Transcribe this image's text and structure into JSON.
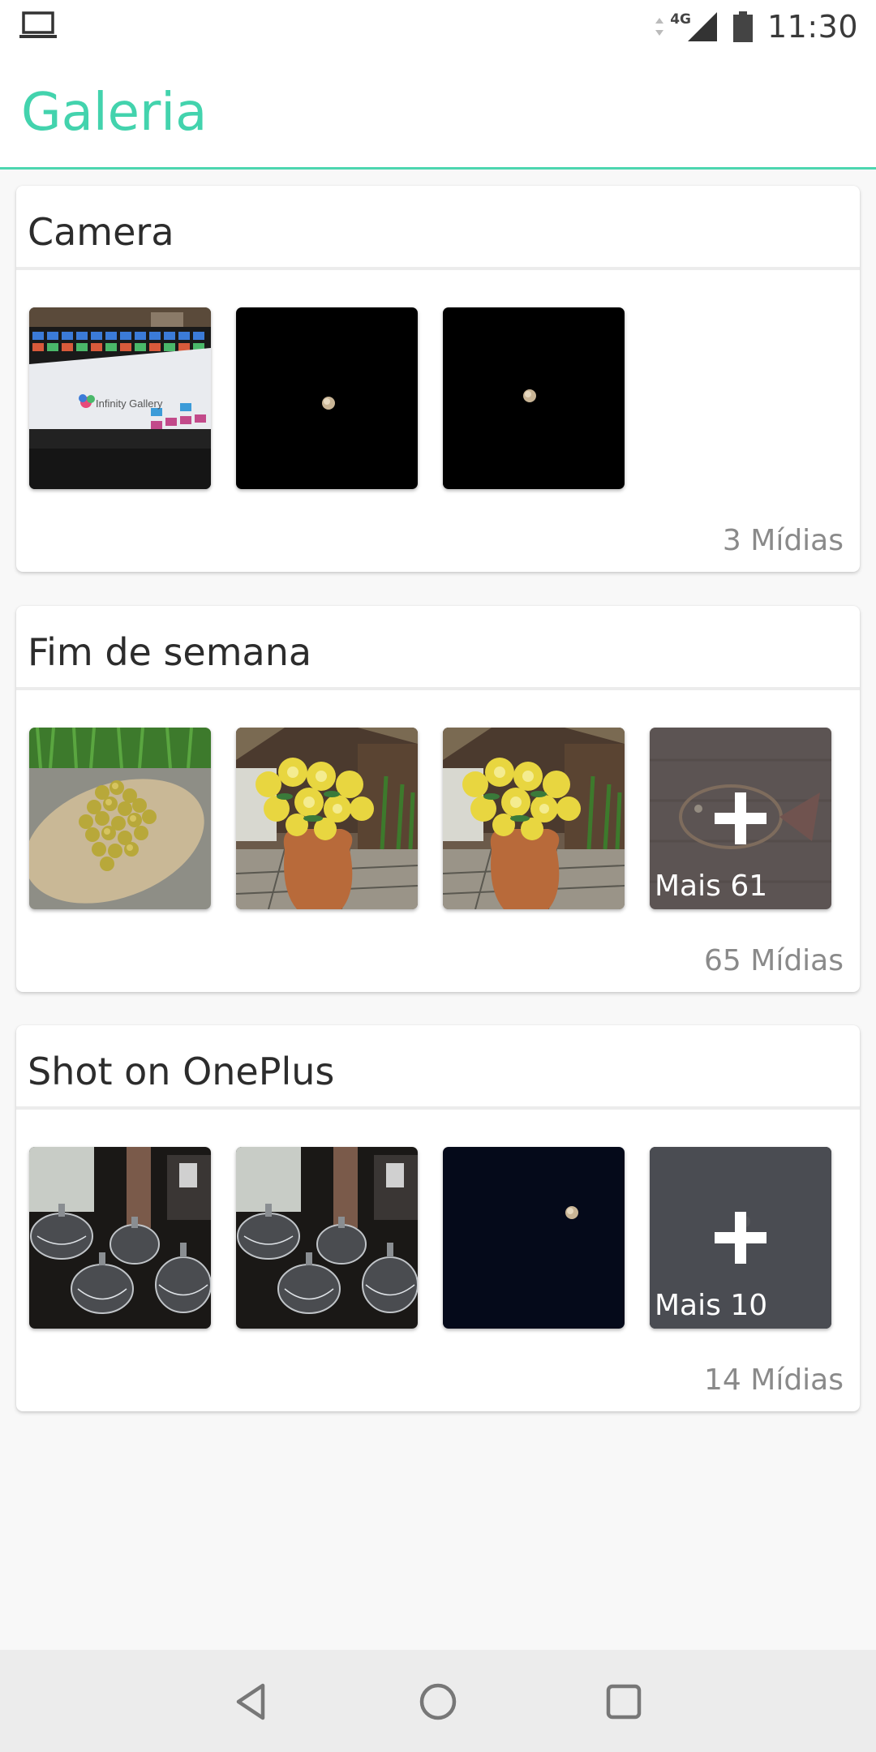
{
  "status_bar": {
    "left_icon": "laptop-icon",
    "network_label": "4G",
    "time": "11:30",
    "icons": [
      "data-arrows-icon",
      "signal-icon",
      "battery-icon"
    ]
  },
  "app_bar": {
    "title": "Galeria"
  },
  "colors": {
    "accent": "#43d3ad",
    "navbar": "#ececec",
    "more_overlay": "#4a4d52"
  },
  "albums": [
    {
      "title": "Camera",
      "count_label": "3 Mídias",
      "thumbnails": [
        {
          "name": "laptop-screen-photo",
          "overlay_text": "Infinity Gallery"
        },
        {
          "name": "moon-photo-1"
        },
        {
          "name": "moon-photo-2"
        }
      ]
    },
    {
      "title": "Fim de semana",
      "count_label": "65 Mídias",
      "thumbnails": [
        {
          "name": "berries-on-leaf-photo"
        },
        {
          "name": "yellow-flowers-vase-photo-1"
        },
        {
          "name": "yellow-flowers-vase-photo-2"
        },
        {
          "name": "fish-wall-decor-photo"
        }
      ],
      "more_label": "Mais 61"
    },
    {
      "title": "Shot on OnePlus",
      "count_label": "14 Mídias",
      "thumbnails": [
        {
          "name": "glass-jars-photo-1"
        },
        {
          "name": "glass-jars-photo-2"
        },
        {
          "name": "night-moon-photo"
        },
        {
          "name": "moon-photo-dim"
        }
      ],
      "more_label": "Mais 10"
    }
  ],
  "nav_bar": {
    "icons": [
      "back-icon",
      "home-icon",
      "recents-icon"
    ]
  }
}
